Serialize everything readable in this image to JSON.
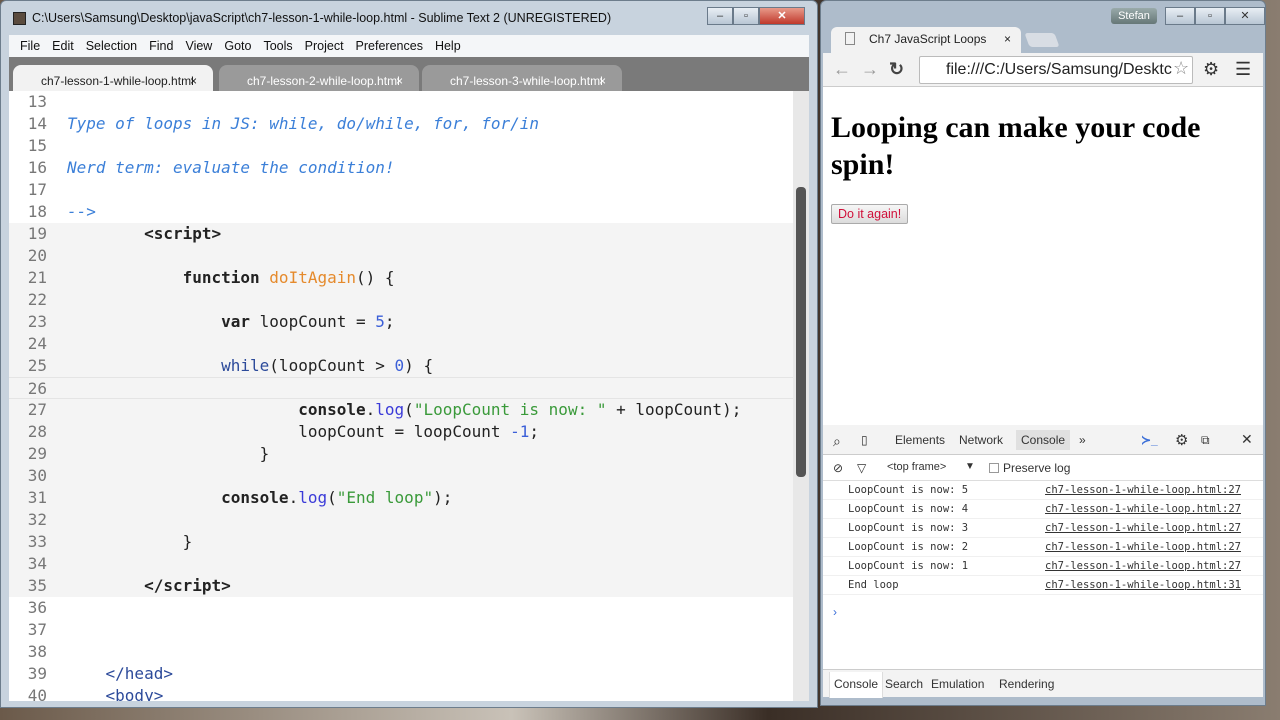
{
  "sublime": {
    "title": "C:\\Users\\Samsung\\Desktop\\javaScript\\ch7-lesson-1-while-loop.html - Sublime Text 2 (UNREGISTERED)",
    "menu": [
      "File",
      "Edit",
      "Selection",
      "Find",
      "View",
      "Goto",
      "Tools",
      "Project",
      "Preferences",
      "Help"
    ],
    "tabs": [
      {
        "label": "ch7-lesson-1-while-loop.html",
        "close": "×"
      },
      {
        "label": "ch7-lesson-2-while-loop.html",
        "close": "×"
      },
      {
        "label": "ch7-lesson-3-while-loop.html",
        "close": "×"
      }
    ],
    "active_tab": 0,
    "current_line": "26",
    "lines": [
      {
        "n": "13",
        "t": []
      },
      {
        "n": "14",
        "t": [
          [
            "Type of loops in JS: while, do/while, for, for/in",
            "c"
          ]
        ]
      },
      {
        "n": "15",
        "t": []
      },
      {
        "n": "16",
        "t": [
          [
            "Nerd term: evaluate the condition!",
            "c"
          ]
        ]
      },
      {
        "n": "17",
        "t": []
      },
      {
        "n": "18",
        "t": [
          [
            "-->",
            "c"
          ]
        ]
      },
      {
        "n": "19",
        "t": [
          [
            "        ",
            "p"
          ],
          [
            "<script>",
            "k"
          ]
        ]
      },
      {
        "n": "20",
        "t": []
      },
      {
        "n": "21",
        "t": [
          [
            "            ",
            "p"
          ],
          [
            "function",
            "k"
          ],
          [
            " ",
            "p"
          ],
          [
            "doItAgain",
            "f"
          ],
          [
            "() {",
            "p"
          ]
        ]
      },
      {
        "n": "22",
        "t": []
      },
      {
        "n": "23",
        "t": [
          [
            "                ",
            "p"
          ],
          [
            "var",
            "k"
          ],
          [
            " loopCount = ",
            "p"
          ],
          [
            "5",
            "n"
          ],
          [
            ";",
            "p"
          ]
        ]
      },
      {
        "n": "24",
        "t": []
      },
      {
        "n": "25",
        "t": [
          [
            "                ",
            "p"
          ],
          [
            "while",
            "w"
          ],
          [
            "(loopCount > ",
            "p"
          ],
          [
            "0",
            "n"
          ],
          [
            ") {",
            "p"
          ]
        ]
      },
      {
        "n": "26",
        "t": []
      },
      {
        "n": "27",
        "t": [
          [
            "                        ",
            "p"
          ],
          [
            "console",
            "k"
          ],
          [
            ".",
            "p"
          ],
          [
            "log",
            "m"
          ],
          [
            "(",
            "p"
          ],
          [
            "\"LoopCount is now: \"",
            "s"
          ],
          [
            " + loopCount);",
            "p"
          ]
        ]
      },
      {
        "n": "28",
        "t": [
          [
            "                        ",
            "p"
          ],
          [
            "loopCount = loopCount ",
            "p"
          ],
          [
            "-1",
            "n"
          ],
          [
            ";",
            "p"
          ]
        ]
      },
      {
        "n": "29",
        "t": [
          [
            "                    }",
            "p"
          ]
        ]
      },
      {
        "n": "30",
        "t": []
      },
      {
        "n": "31",
        "t": [
          [
            "                ",
            "p"
          ],
          [
            "console",
            "k"
          ],
          [
            ".",
            "p"
          ],
          [
            "log",
            "m"
          ],
          [
            "(",
            "p"
          ],
          [
            "\"End loop\"",
            "s"
          ],
          [
            ");",
            "p"
          ]
        ]
      },
      {
        "n": "32",
        "t": []
      },
      {
        "n": "33",
        "t": [
          [
            "            }",
            "p"
          ]
        ]
      },
      {
        "n": "34",
        "t": []
      },
      {
        "n": "35",
        "t": [
          [
            "        ",
            "p"
          ],
          [
            "</script>",
            "k"
          ]
        ]
      },
      {
        "n": "36",
        "t": []
      },
      {
        "n": "37",
        "t": []
      },
      {
        "n": "38",
        "t": []
      },
      {
        "n": "39",
        "t": [
          [
            "    ",
            "p"
          ],
          [
            "</head>",
            "w"
          ]
        ]
      },
      {
        "n": "40",
        "t": [
          [
            "    ",
            "p"
          ],
          [
            "<body>",
            "w"
          ]
        ]
      }
    ]
  },
  "chrome": {
    "tab_title": "Ch7 JavaScript Loops",
    "tab_close": "×",
    "user": "Stefan",
    "url": "file:///C:/Users/Samsung/Desktc",
    "heading": "Looping can make your code spin!",
    "button": "Do it again!",
    "devtools": {
      "tabs": [
        "Elements",
        "Network",
        "Console",
        "»"
      ],
      "active": "Console",
      "frame": "<top frame>",
      "preserve_log": "Preserve log",
      "prompt": "›",
      "messages": [
        {
          "msg": "LoopCount is now: 5",
          "src": "ch7-lesson-1-while-loop.html:27"
        },
        {
          "msg": "LoopCount is now: 4",
          "src": "ch7-lesson-1-while-loop.html:27"
        },
        {
          "msg": "LoopCount is now: 3",
          "src": "ch7-lesson-1-while-loop.html:27"
        },
        {
          "msg": "LoopCount is now: 2",
          "src": "ch7-lesson-1-while-loop.html:27"
        },
        {
          "msg": "LoopCount is now: 1",
          "src": "ch7-lesson-1-while-loop.html:27"
        },
        {
          "msg": "End loop",
          "src": "ch7-lesson-1-while-loop.html:31"
        }
      ],
      "drawer_tabs": [
        "Console",
        "Search",
        "Emulation",
        "Rendering"
      ]
    }
  }
}
